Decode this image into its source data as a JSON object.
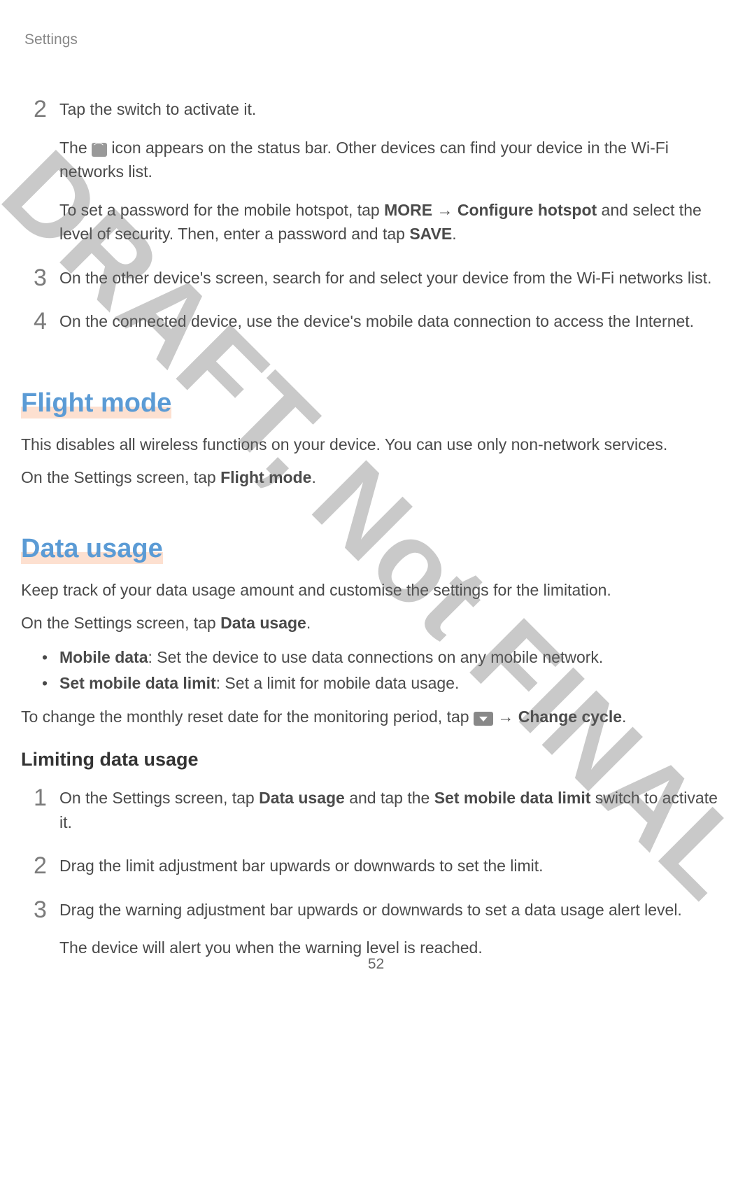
{
  "header": "Settings",
  "pageNumber": "52",
  "watermark": "DRAFT, Not FINAL",
  "topSteps": [
    {
      "num": "2",
      "paras": [
        {
          "segments": [
            {
              "t": "Tap the switch to activate it."
            }
          ]
        },
        {
          "segments": [
            {
              "t": "The "
            },
            {
              "icon": "wifi"
            },
            {
              "t": " icon appears on the status bar. Other devices can find your device in the Wi-Fi networks list."
            }
          ]
        },
        {
          "segments": [
            {
              "t": "To set a password for the mobile hotspot, tap "
            },
            {
              "t": "MORE",
              "bold": true
            },
            {
              "t": " → "
            },
            {
              "t": "Configure hotspot",
              "bold": true
            },
            {
              "t": " and select the level of security. Then, enter a password and tap "
            },
            {
              "t": "SAVE",
              "bold": true
            },
            {
              "t": "."
            }
          ]
        }
      ]
    },
    {
      "num": "3",
      "paras": [
        {
          "segments": [
            {
              "t": "On the other device's screen, search for and select your device from the Wi-Fi networks list."
            }
          ]
        }
      ]
    },
    {
      "num": "4",
      "paras": [
        {
          "segments": [
            {
              "t": "On the connected device, use the device's mobile data connection to access the Internet."
            }
          ]
        }
      ]
    }
  ],
  "flightMode": {
    "heading": "Flight mode",
    "paras": [
      {
        "segments": [
          {
            "t": "This disables all wireless functions on your device. You can use only non-network services."
          }
        ]
      },
      {
        "segments": [
          {
            "t": "On the Settings screen, tap "
          },
          {
            "t": "Flight mode",
            "bold": true
          },
          {
            "t": "."
          }
        ]
      }
    ]
  },
  "dataUsage": {
    "heading": "Data usage",
    "paras": [
      {
        "segments": [
          {
            "t": "Keep track of your data usage amount and customise the settings for the limitation."
          }
        ]
      },
      {
        "segments": [
          {
            "t": "On the Settings screen, tap "
          },
          {
            "t": "Data usage",
            "bold": true
          },
          {
            "t": "."
          }
        ]
      }
    ],
    "bullets": [
      {
        "segments": [
          {
            "t": "Mobile data",
            "bold": true
          },
          {
            "t": ": Set the device to use data connections on any mobile network."
          }
        ]
      },
      {
        "segments": [
          {
            "t": "Set mobile data limit",
            "bold": true
          },
          {
            "t": ": Set a limit for mobile data usage."
          }
        ]
      }
    ],
    "afterBullets": [
      {
        "segments": [
          {
            "t": "To change the monthly reset date for the monitoring period, tap "
          },
          {
            "icon": "dropdown"
          },
          {
            "t": " → "
          },
          {
            "t": "Change cycle",
            "bold": true
          },
          {
            "t": "."
          }
        ]
      }
    ],
    "subHeading": "Limiting data usage",
    "steps": [
      {
        "num": "1",
        "paras": [
          {
            "segments": [
              {
                "t": "On the Settings screen, tap "
              },
              {
                "t": "Data usage",
                "bold": true
              },
              {
                "t": " and tap the "
              },
              {
                "t": "Set mobile data limit",
                "bold": true
              },
              {
                "t": " switch to activate it."
              }
            ]
          }
        ]
      },
      {
        "num": "2",
        "paras": [
          {
            "segments": [
              {
                "t": "Drag the limit adjustment bar upwards or downwards to set the limit."
              }
            ]
          }
        ]
      },
      {
        "num": "3",
        "paras": [
          {
            "segments": [
              {
                "t": "Drag the warning adjustment bar upwards or downwards to set a data usage alert level."
              }
            ]
          },
          {
            "segments": [
              {
                "t": "The device will alert you when the warning level is reached."
              }
            ]
          }
        ]
      }
    ]
  }
}
